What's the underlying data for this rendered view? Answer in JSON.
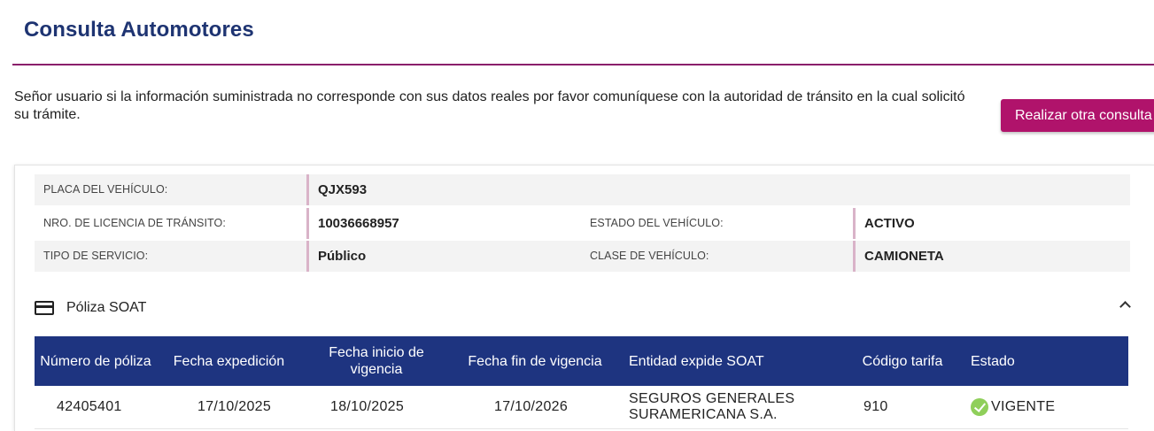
{
  "header": {
    "title": "Consulta Automotores"
  },
  "notice": "Señor usuario si la información suministrada no corresponde con sus datos reales por favor comuníquese con la autoridad de tránsito en la cual solicitó su trámite.",
  "actions": {
    "new_query_label": "Realizar otra consulta"
  },
  "vehicle": {
    "plate_label": "PLACA DEL VEHÍCULO:",
    "plate_value": "QJX593",
    "license_label": "NRO. DE LICENCIA DE TRÁNSITO:",
    "license_value": "10036668957",
    "state_label": "ESTADO DEL VEHÍCULO:",
    "state_value": "ACTIVO",
    "service_label": "TIPO DE SERVICIO:",
    "service_value": "Público",
    "class_label": "CLASE DE VEHÍCULO:",
    "class_value": "CAMIONETA"
  },
  "soat": {
    "section_title": "Póliza SOAT",
    "columns": [
      "Número de póliza",
      "Fecha expedición",
      "Fecha inicio de vigencia",
      "Fecha fin de vigencia",
      "Entidad expide SOAT",
      "Código tarifa",
      "Estado"
    ],
    "rows": [
      {
        "policy": "42405401",
        "issued": "17/10/2025",
        "start": "18/10/2025",
        "end": "17/10/2026",
        "entity": "SEGUROS GENERALES SURAMERICANA S.A.",
        "tariff": "910",
        "status": "VIGENTE"
      }
    ]
  },
  "colors": {
    "brand_blue": "#1e3480",
    "accent_magenta": "#b0136b",
    "status_ok": "#8fcf5a"
  },
  "icons": {
    "soat": "credit-card-icon",
    "collapse": "chevron-up-icon",
    "status": "check-circle-icon"
  }
}
